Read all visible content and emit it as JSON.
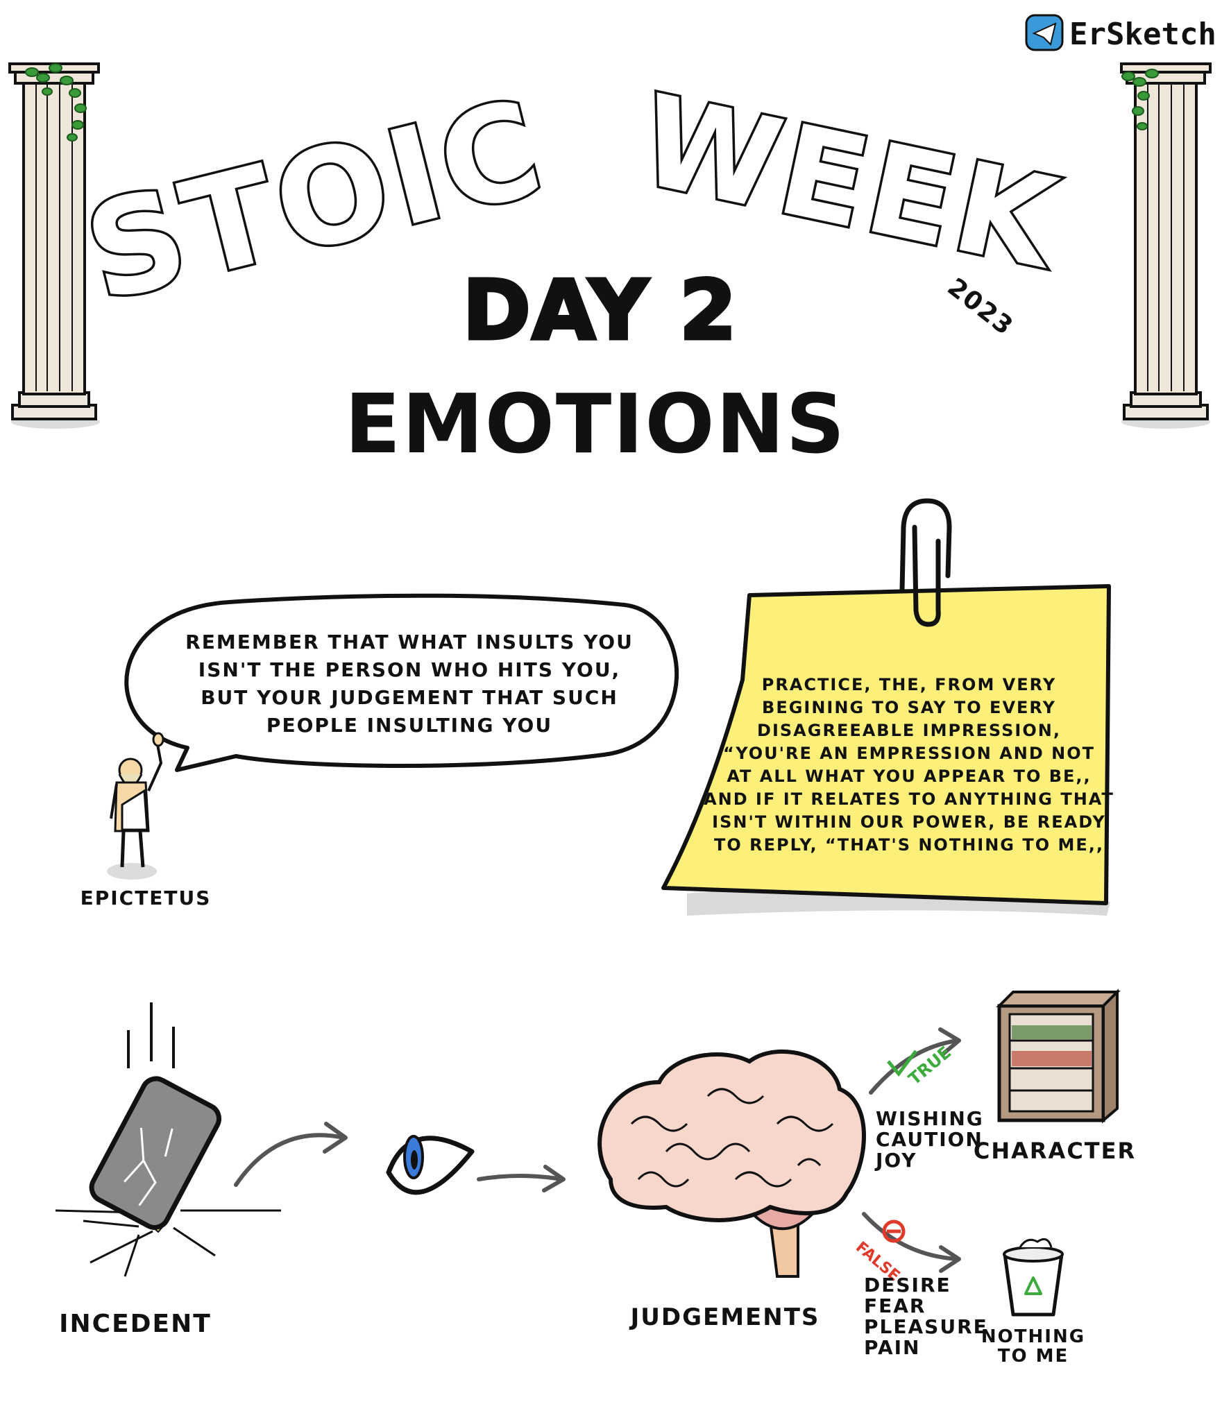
{
  "brand": {
    "name": "ErSketch",
    "icon": "telegram-icon",
    "icon_color": "#3a9ad9"
  },
  "header": {
    "title_word_1": "STOIC",
    "title_word_2": "WEEK",
    "year": "2023",
    "day": "DAY 2",
    "topic": "EMOTIONS"
  },
  "quote_bubble": {
    "lines": [
      "REMEMBER THAT WHAT  INSULTS  YOU",
      "ISN'T THE PERSON  WHO  HITS  YOU,",
      "BUT  YOUR  JUDGEMENT  THAT SUCH",
      "PEOPLE    INSULTING  YOU"
    ],
    "speaker": "EPICTETUS"
  },
  "sticky_note": {
    "lines": [
      "PRACTICE, THE, FROM  VERY",
      "BEGINING TO SAY TO EVERY",
      "DISAGREEABLE  IMPRESSION,",
      "“YOU'RE AN EMPRESSION AND NOT",
      "AT  ALL WHAT  YOU APPEAR TO BE,,",
      "AND IF IT RELATES TO ANYTHING THAT",
      "ISN'T WITHIN  OUR  POWER, BE READY",
      "TO  REPLY, “THAT'S  NOTHING TO ME,,"
    ],
    "color": "#fdf07a"
  },
  "flow": {
    "incident_label": "INCEDENT",
    "judgements_label": "JUDGEMENTS",
    "true_tag": "TRUE",
    "true_list": [
      "WISHING",
      "CAUTION",
      "JOY"
    ],
    "character_label": "CHARACTER",
    "false_tag": "FALSE",
    "false_list": [
      "DESIRE",
      "FEAR",
      "PLEASURE",
      "PAIN"
    ],
    "nothing_label_1": "NOTHING",
    "nothing_label_2": "TO ME",
    "true_color": "#3caa3c",
    "false_color": "#e03a2a"
  }
}
